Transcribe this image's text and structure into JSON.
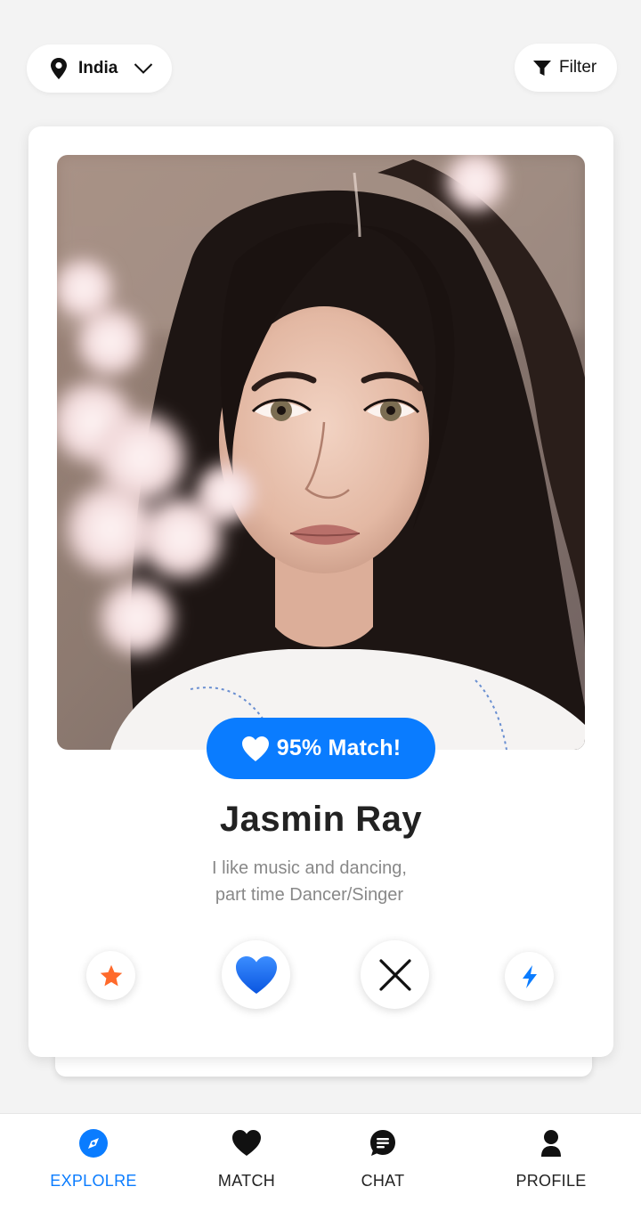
{
  "header": {
    "location": "India",
    "filter_label": "Filter"
  },
  "profile": {
    "match_label": "95% Match!",
    "name": "Jasmin Ray",
    "bio_line1": "I like music and dancing,",
    "bio_line2": "part time Dancer/Singer"
  },
  "actions": [
    {
      "icon": "star-icon",
      "color": "#ff6a2b"
    },
    {
      "icon": "heart-icon",
      "color": "#0a7cff"
    },
    {
      "icon": "close-icon",
      "color": "#111111"
    },
    {
      "icon": "lightning-icon",
      "color": "#0a7cff"
    }
  ],
  "nav": {
    "explore": "EXPLOLRE",
    "match": "MATCH",
    "chat": "CHAT",
    "profile": "PROFILE",
    "active": "explore"
  },
  "colors": {
    "accent": "#0a7cff",
    "star": "#ff6a2b",
    "background": "#f3f3f3"
  }
}
